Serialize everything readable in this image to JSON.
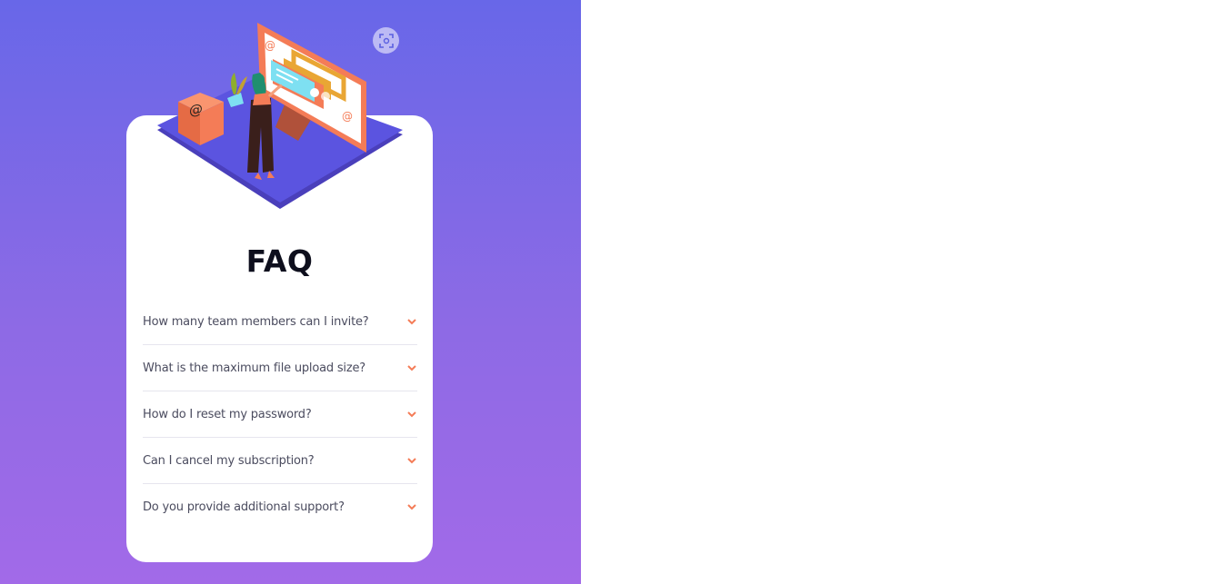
{
  "faq": {
    "title": "FAQ",
    "items": [
      {
        "question": "How many team members can I invite?"
      },
      {
        "question": "What is the maximum file upload size?"
      },
      {
        "question": "How do I reset my password?"
      },
      {
        "question": "Can I cancel my subscription?"
      },
      {
        "question": "Do you provide additional support?"
      }
    ]
  },
  "icons": {
    "scan": "scan-icon",
    "expand": "chevron-down-icon",
    "illustration": "woman-online-desktop-illustration"
  },
  "colors": {
    "gradient_top": "#6867e8",
    "gradient_bottom": "#a26ae8",
    "accent": "#f47c57",
    "title": "#0e0f1d",
    "question": "#4b4c5f",
    "divider": "#e6e5ee"
  }
}
